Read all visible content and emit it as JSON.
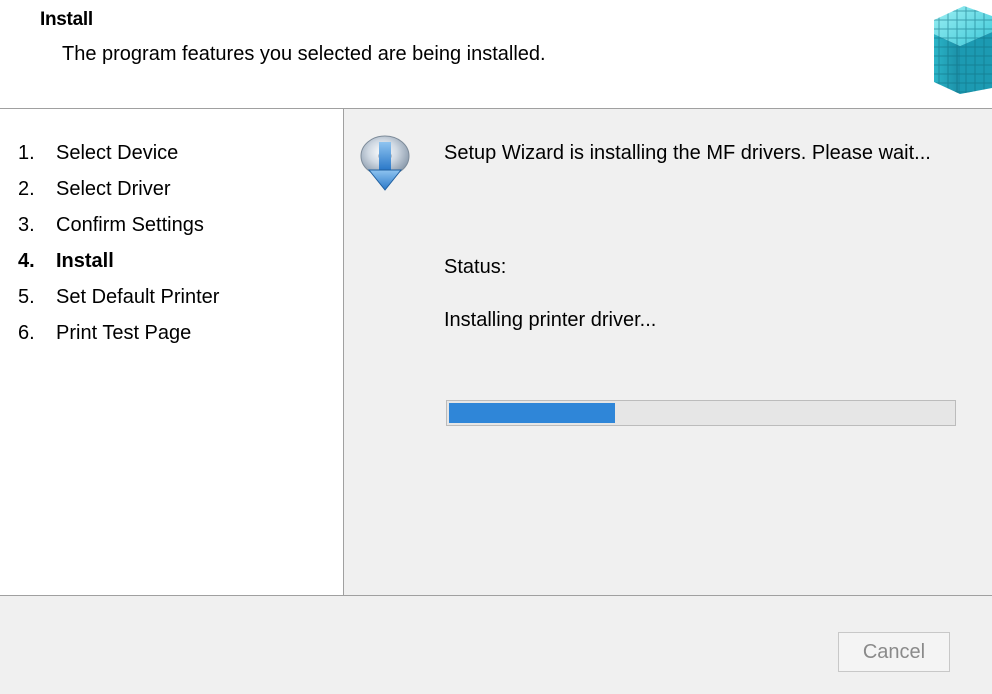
{
  "header": {
    "title": "Install",
    "subtitle": "The program features you selected are being installed."
  },
  "steps": [
    {
      "num": "1.",
      "label": "Select Device",
      "active": false
    },
    {
      "num": "2.",
      "label": "Select Driver",
      "active": false
    },
    {
      "num": "3.",
      "label": "Confirm Settings",
      "active": false
    },
    {
      "num": "4.",
      "label": "Install",
      "active": true
    },
    {
      "num": "5.",
      "label": "Set Default Printer",
      "active": false
    },
    {
      "num": "6.",
      "label": "Print Test Page",
      "active": false
    }
  ],
  "content": {
    "message": "Setup Wizard is installing the MF drivers. Please wait...",
    "status_label": "Status:",
    "status_text": "Installing printer driver...",
    "progress_fraction": 0.33
  },
  "footer": {
    "cancel_label": "Cancel",
    "cancel_disabled": true
  },
  "colors": {
    "progress_fill": "#2f86d8",
    "icon_cube": "#2bb5c8"
  },
  "icons": {
    "header": "installer-cube-icon",
    "content": "disc-download-icon"
  }
}
